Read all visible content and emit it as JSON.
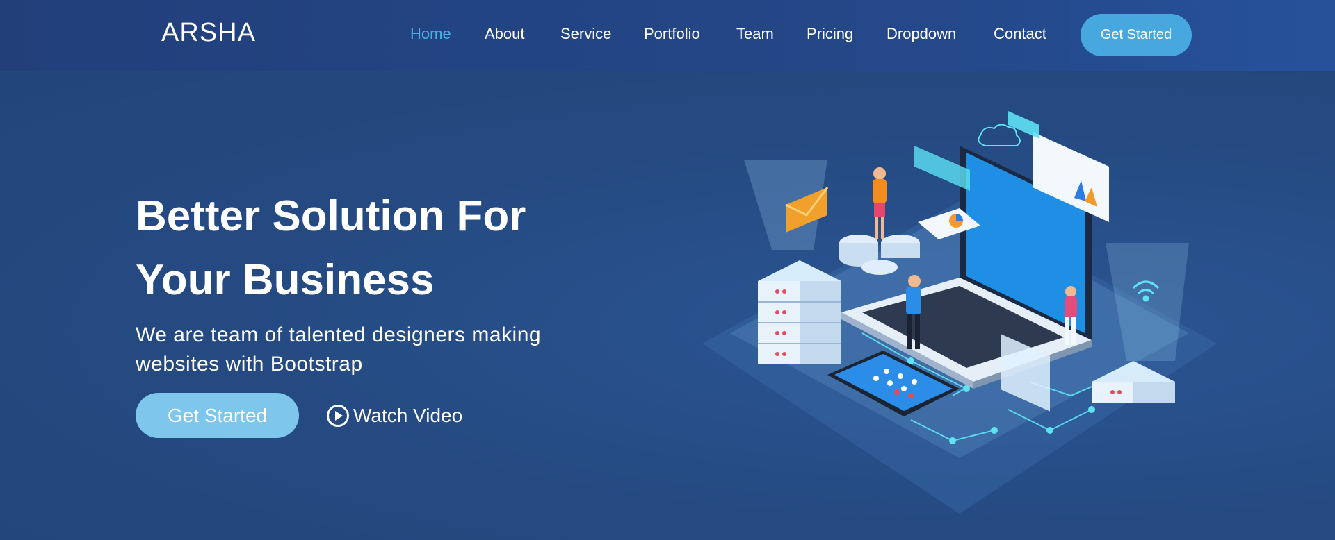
{
  "header": {
    "logo": "ARSHA",
    "nav": [
      {
        "label": "Home",
        "active": true
      },
      {
        "label": "About",
        "active": false
      },
      {
        "label": "Service",
        "active": false
      },
      {
        "label": "Portfolio",
        "active": false
      },
      {
        "label": "Team",
        "active": false
      },
      {
        "label": "Pricing",
        "active": false
      },
      {
        "label": "Dropdown",
        "active": false
      },
      {
        "label": "Contact",
        "active": false
      }
    ],
    "cta_label": "Get Started"
  },
  "hero": {
    "title_line1": "Better Solution For",
    "title_line2": "Your Business",
    "subtitle_line1": "We are team of talented designers making",
    "subtitle_line2": "websites with Bootstrap",
    "primary_button": "Get Started",
    "video_link": "Watch Video",
    "video_icon": "play-circle-icon",
    "illustration": "isometric-technology-illustration"
  },
  "colors": {
    "background": "#254a82",
    "header": "#223f7a",
    "accent": "#47b2e4",
    "hero_button": "#7ec6ec"
  }
}
